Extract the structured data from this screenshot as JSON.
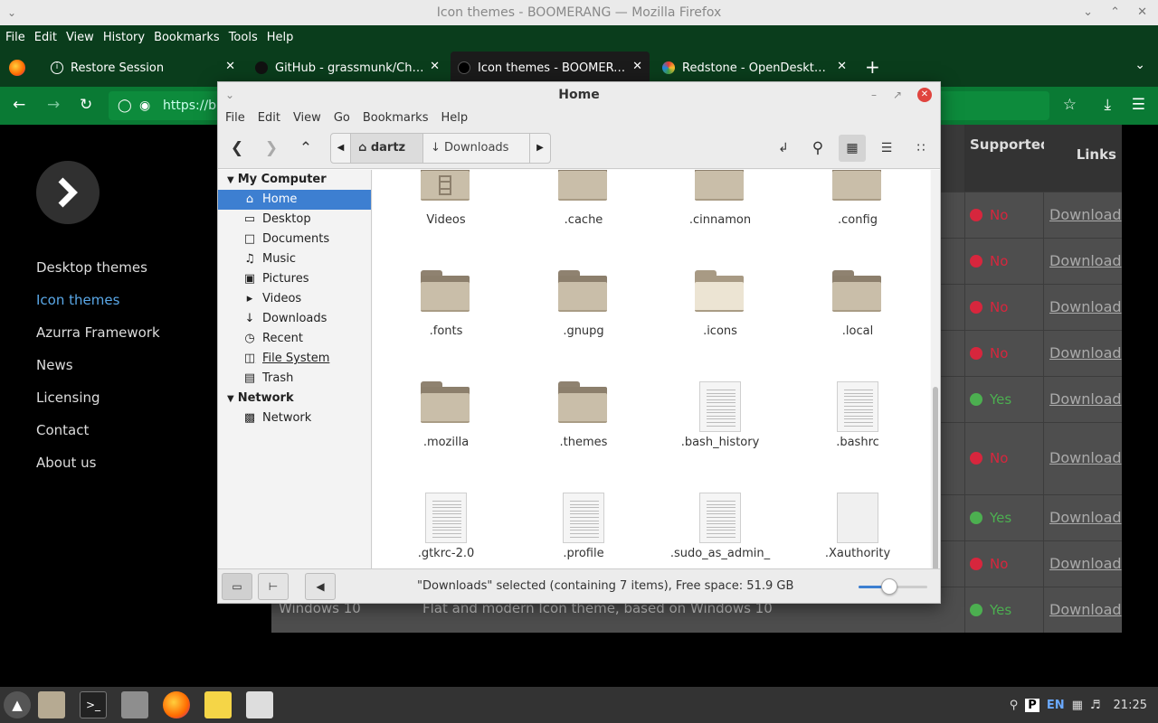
{
  "firefox": {
    "window_title": "Icon themes - BOOMERANG — Mozilla Firefox",
    "menu": [
      "File",
      "Edit",
      "View",
      "History",
      "Bookmarks",
      "Tools",
      "Help"
    ],
    "tabs": [
      {
        "label": "Restore Session",
        "icon": "info-icon"
      },
      {
        "label": "GitHub - grassmunk/Chicago",
        "icon": "github-icon"
      },
      {
        "label": "Icon themes - BOOMERANG",
        "icon": "boomerang-icon",
        "active": true
      },
      {
        "label": "Redstone - OpenDesktop.org",
        "icon": "opendesktop-icon"
      }
    ],
    "url": "https://b0"
  },
  "site": {
    "nav": [
      "Desktop themes",
      "Icon themes",
      "Azurra Framework",
      "News",
      "Licensing",
      "Contact",
      "About us"
    ],
    "active_nav": "Icon themes",
    "table_headers": {
      "supported": "Supported",
      "links": "Links"
    },
    "rows": [
      {
        "supported": "No",
        "link": "Download"
      },
      {
        "supported": "No",
        "link": "Download"
      },
      {
        "supported": "No",
        "link": "Download"
      },
      {
        "supported": "No",
        "link": "Download"
      },
      {
        "supported": "Yes",
        "link": "Download"
      },
      {
        "supported": "No",
        "link": "Download"
      },
      {
        "supported": "Yes",
        "link": "Download"
      },
      {
        "supported": "No",
        "link": "Download"
      },
      {
        "name": "Windows 10",
        "description": "Flat and modern Icon theme, based on Windows 10",
        "supported": "Yes",
        "link": "Download"
      }
    ],
    "colors": {
      "no": "#d7263d",
      "yes": "#4caf50"
    }
  },
  "nemo": {
    "title": "Home",
    "menu": [
      "File",
      "Edit",
      "View",
      "Go",
      "Bookmarks",
      "Help"
    ],
    "breadcrumb": {
      "home": "dartz",
      "current": "Downloads"
    },
    "sidebar": {
      "my_computer": "My Computer",
      "places": [
        {
          "label": "Home",
          "icon": "home-icon",
          "selected": true
        },
        {
          "label": "Desktop",
          "icon": "desktop-icon"
        },
        {
          "label": "Documents",
          "icon": "documents-icon"
        },
        {
          "label": "Music",
          "icon": "music-icon"
        },
        {
          "label": "Pictures",
          "icon": "pictures-icon"
        },
        {
          "label": "Videos",
          "icon": "videos-icon"
        },
        {
          "label": "Downloads",
          "icon": "downloads-icon"
        },
        {
          "label": "Recent",
          "icon": "recent-icon"
        },
        {
          "label": "File System",
          "icon": "filesystem-icon"
        },
        {
          "label": "Trash",
          "icon": "trash-icon"
        }
      ],
      "network_header": "Network",
      "network_items": [
        {
          "label": "Network",
          "icon": "network-icon"
        }
      ]
    },
    "files": [
      {
        "name": "Videos",
        "type": "folder-videos"
      },
      {
        "name": ".cache",
        "type": "folder"
      },
      {
        "name": ".cinnamon",
        "type": "folder"
      },
      {
        "name": ".config",
        "type": "folder"
      },
      {
        "name": ".fonts",
        "type": "folder"
      },
      {
        "name": ".gnupg",
        "type": "folder"
      },
      {
        "name": ".icons",
        "type": "folder-light"
      },
      {
        "name": ".local",
        "type": "folder"
      },
      {
        "name": ".mozilla",
        "type": "folder"
      },
      {
        "name": ".themes",
        "type": "folder"
      },
      {
        "name": ".bash_history",
        "type": "text"
      },
      {
        "name": ".bashrc",
        "type": "text"
      },
      {
        "name": ".gtkrc-2.0",
        "type": "text"
      },
      {
        "name": ".profile",
        "type": "text"
      },
      {
        "name": ".sudo_as_admin_",
        "type": "text"
      },
      {
        "name": ".Xauthority",
        "type": "blank"
      }
    ],
    "status": "\"Downloads\" selected (containing 7 items), Free space: 51.9 GB",
    "zoom_level": 0.45
  },
  "taskbar": {
    "lang": "EN",
    "clock": "21:25"
  }
}
